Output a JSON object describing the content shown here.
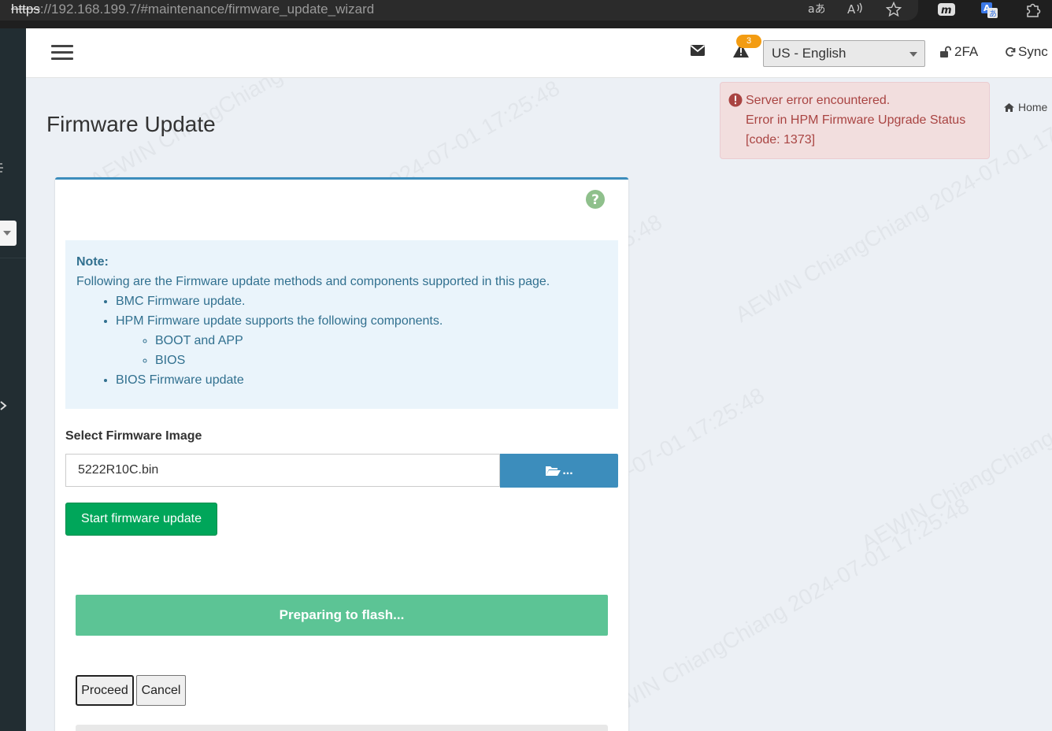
{
  "browser": {
    "url_scheme": "https",
    "url_rest": "://192.168.199.7/#maintenance/firmware_update_wizard",
    "icons": [
      "read-aloud-icon",
      "translate-icon",
      "favorite-icon",
      "extension-m-icon",
      "translate-a-icon",
      "puzzle-icon"
    ]
  },
  "header": {
    "alert_count": "3",
    "language": "US - English",
    "twofa_label": "2FA",
    "sync_label": "Sync"
  },
  "page": {
    "title": "Firmware Update",
    "breadcrumb_home": "Home"
  },
  "alert": {
    "line1": "Server error encountered.",
    "line2": "Error in HPM Firmware Upgrade Status",
    "line3": "[code: 1373]"
  },
  "note": {
    "title": "Note:",
    "intro": "Following are the Firmware update methods and components supported in this page.",
    "item_bmc": "BMC Firmware update.",
    "item_hpm": "HPM Firmware update supports the following components.",
    "sub_boot": "BOOT and APP",
    "sub_bios": "BIOS",
    "item_bios": "BIOS Firmware update"
  },
  "form": {
    "select_label": "Select Firmware Image",
    "file_value": "5222R10C.bin",
    "browse_label": "...",
    "start_button": "Start firmware update"
  },
  "progress": {
    "text": "Preparing to flash..."
  },
  "actions": {
    "proceed": "Proceed",
    "cancel": "Cancel"
  },
  "watermark": "AEWIN ChiangChiang 2024-07-01 17:25:48",
  "colors": {
    "primary": "#3c8dbc",
    "success": "#00a65a",
    "progress": "#5cc495",
    "danger_text": "#a94442",
    "danger_bg": "#f2dede",
    "warning_badge": "#f39c12",
    "sidebar": "#222d32"
  }
}
